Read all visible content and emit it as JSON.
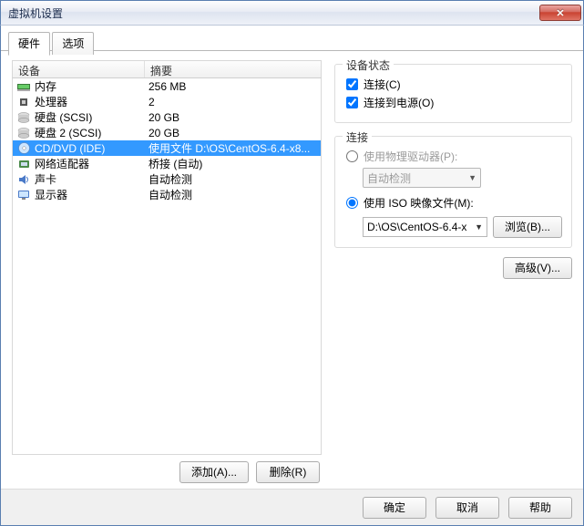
{
  "window": {
    "title": "虚拟机设置",
    "close": "✕"
  },
  "tabs": {
    "hardware": "硬件",
    "options": "选项"
  },
  "columns": {
    "device": "设备",
    "summary": "摘要"
  },
  "devices": [
    {
      "icon": "memory",
      "name": "内存",
      "summary": "256 MB"
    },
    {
      "icon": "cpu",
      "name": "处理器",
      "summary": "2"
    },
    {
      "icon": "disk",
      "name": "硬盘 (SCSI)",
      "summary": "20 GB"
    },
    {
      "icon": "disk",
      "name": "硬盘 2 (SCSI)",
      "summary": "20 GB"
    },
    {
      "icon": "cd",
      "name": "CD/DVD (IDE)",
      "summary": "使用文件 D:\\OS\\CentOS-6.4-x8..."
    },
    {
      "icon": "net",
      "name": "网络适配器",
      "summary": "桥接 (自动)"
    },
    {
      "icon": "sound",
      "name": "声卡",
      "summary": "自动检测"
    },
    {
      "icon": "display",
      "name": "显示器",
      "summary": "自动检测"
    }
  ],
  "selected_index": 4,
  "buttons": {
    "add": "添加(A)...",
    "remove": "删除(R)",
    "ok": "确定",
    "cancel": "取消",
    "help": "帮助",
    "browse": "浏览(B)...",
    "advanced": "高级(V)..."
  },
  "groups": {
    "status": {
      "title": "设备状态",
      "connected": "连接(C)",
      "connect_at_power": "连接到电源(O)"
    },
    "connection": {
      "title": "连接",
      "use_physical": "使用物理驱动器(P):",
      "auto_detect": "自动检测",
      "use_iso": "使用 ISO 映像文件(M):",
      "iso_path": "D:\\OS\\CentOS-6.4-x"
    }
  }
}
